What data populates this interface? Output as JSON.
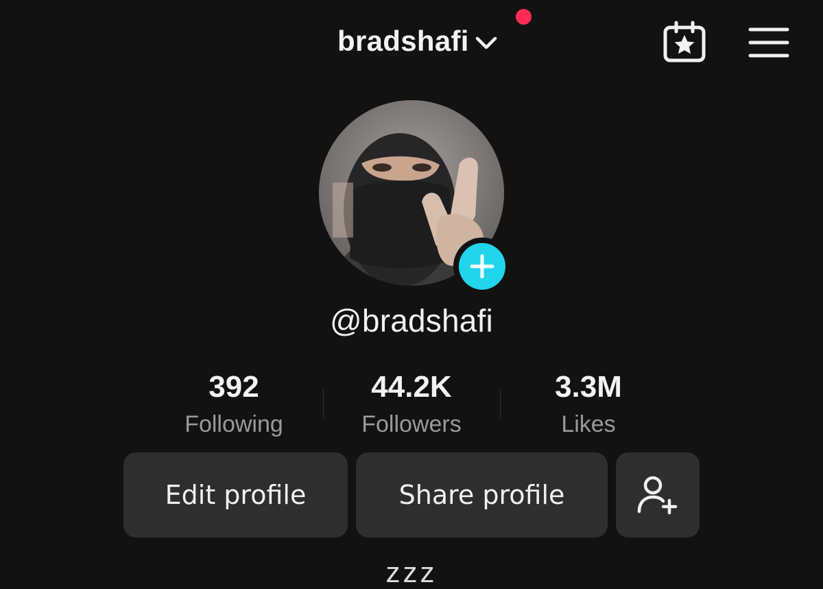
{
  "header": {
    "username": "bradshafi",
    "notification_color": "#fe2c55",
    "icons": {
      "switch": "chevron-down-icon",
      "calendar": "calendar-star-icon",
      "menu": "hamburger-menu-icon"
    }
  },
  "profile": {
    "handle": "@bradshafi",
    "add_button_color": "#20d5ec",
    "add_icon": "plus-icon"
  },
  "stats": [
    {
      "value": "392",
      "label": "Following"
    },
    {
      "value": "44.2K",
      "label": "Followers"
    },
    {
      "value": "3.3M",
      "label": "Likes"
    }
  ],
  "actions": {
    "edit_label": "Edit profile",
    "share_label": "Share profile",
    "add_friend_icon": "add-friend-icon"
  },
  "bio": "zzz"
}
